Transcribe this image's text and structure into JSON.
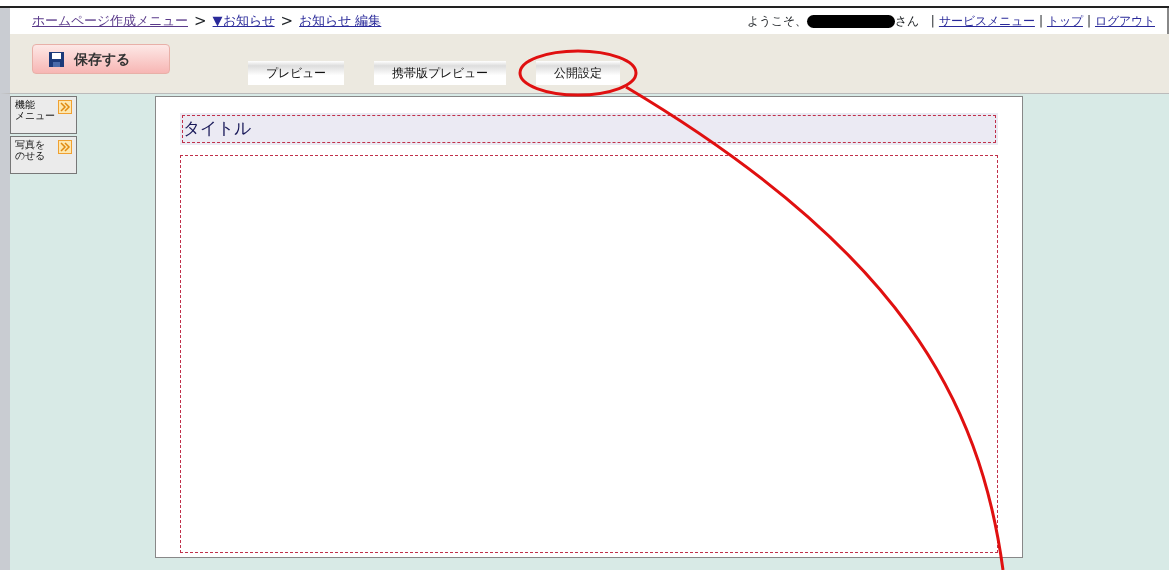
{
  "breadcrumb": [
    {
      "label": "ホームページ作成メニュー",
      "kind": "visited"
    },
    {
      "label": "▼お知らせ",
      "kind": "link"
    },
    {
      "label": "お知らせ 編集",
      "kind": "link"
    }
  ],
  "breadcrumb_separator": ">",
  "user": {
    "greeting": "ようこそ、",
    "suffix": "さん",
    "name_redacted": true
  },
  "link_separator": "|",
  "user_links": [
    "サービスメニュー",
    "トップ",
    "ログアウト"
  ],
  "save_button": {
    "label": "保存する"
  },
  "toolbar_buttons": [
    {
      "label": "プレビュー",
      "highlighted": false
    },
    {
      "label": "携帯版プレビュー",
      "highlighted": false
    },
    {
      "label": "公開設定",
      "highlighted": true
    }
  ],
  "side_tabs": [
    {
      "lines": [
        "機能",
        "メニュー"
      ]
    },
    {
      "lines": [
        "写真を",
        "のせる"
      ]
    }
  ],
  "editor": {
    "title": "タイトル"
  }
}
